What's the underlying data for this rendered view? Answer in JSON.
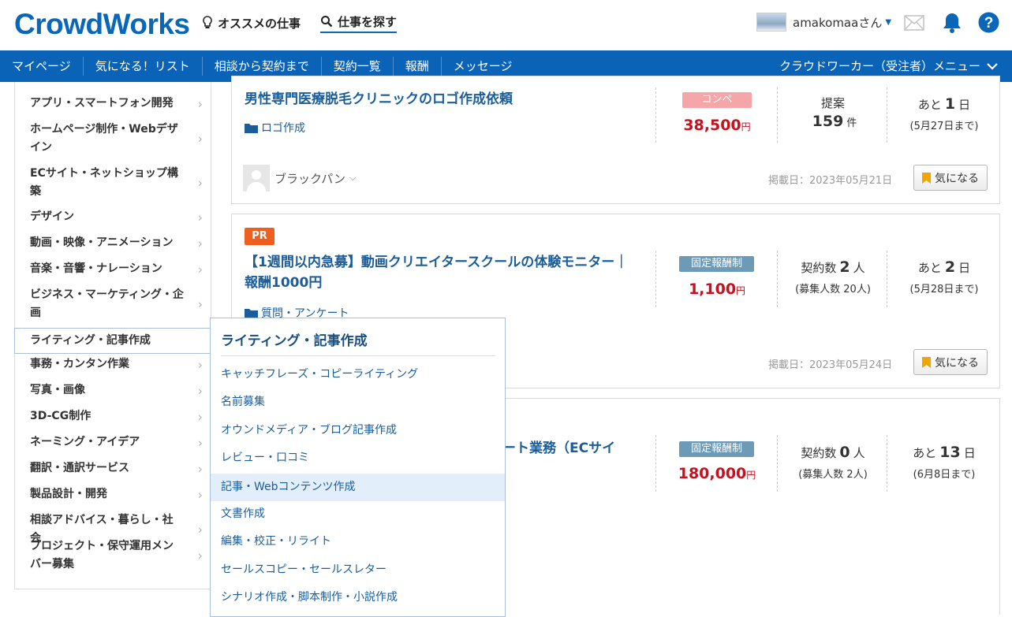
{
  "header": {
    "logo": "CrowdWorks",
    "recommend": "オススメの仕事",
    "search": "仕事を探す",
    "username": "amakomaaさん",
    "icons": [
      "mail-icon",
      "bell-icon",
      "help-icon"
    ]
  },
  "nav": {
    "items": [
      "マイページ",
      "気になる！リスト",
      "相談から契約まで",
      "契約一覧",
      "報酬",
      "メッセージ"
    ],
    "worker_menu": "クラウドワーカー（受注者）メニュー"
  },
  "sidebar": {
    "items": [
      "アプリ・スマートフォン開発",
      "ホームページ制作・Webデザイン",
      "ECサイト・ネットショップ構築",
      "デザイン",
      "動画・映像・アニメーション",
      "音楽・音響・ナレーション",
      "ビジネス・マーケティング・企画",
      "ライティング・記事作成",
      "事務・カンタン作業",
      "写真・画像",
      "3D-CG制作",
      "ネーミング・アイデア",
      "翻訳・通訳サービス",
      "製品設計・開発",
      "相談アドバイス・暮らし・社会",
      "プロジェクト・保守運用メンバー募集"
    ],
    "active": "ライティング・記事作成"
  },
  "dropdown": {
    "title": "ライティング・記事作成",
    "items": [
      "キャッチフレーズ・コピーライティング",
      "名前募集",
      "オウンドメディア・ブログ記事作成",
      "レビュー・口コミ",
      "記事・Webコンテンツ作成",
      "文書作成",
      "編集・校正・リライト",
      "セールスコピー・セールスレター",
      "シナリオ作成・脚本制作・小説作成"
    ],
    "highlighted": "記事・Webコンテンツ作成"
  },
  "jobs": [
    {
      "title": "男性専門医療脱毛クリニックのロゴ作成依頼",
      "category": "ロゴ作成",
      "badge": "コンペ",
      "price": "38,500",
      "price_unit": "円",
      "stat_label": "提案",
      "stat_value": "159",
      "stat_unit": "件",
      "deadline_prefix": "あと",
      "deadline_days": "1",
      "deadline_unit": "日",
      "deadline_date": "(5月27日まで)",
      "client": "ブラックパン",
      "posted": "掲載日：2023年05月21日",
      "fav": "気になる"
    },
    {
      "pr": "PR",
      "title_line1": "【1週間以内急募】動画クリエイタースクールの体験モニター｜",
      "title_line2": "報酬1000円",
      "category": "質問・アンケート",
      "badge": "固定報酬制",
      "price": "1,100",
      "price_unit": "円",
      "stat_label": "契約数",
      "stat_value": "2",
      "stat_unit": "人",
      "stat_sub": "(募集人数 20人)",
      "deadline_prefix": "あと",
      "deadline_days": "2",
      "deadline_unit": "日",
      "deadline_date": "(5月28日まで)",
      "posted": "掲載日：2023年05月24日",
      "fav": "気になる"
    },
    {
      "title_fragment": "ート業務（ECサイ",
      "badge": "固定報酬制",
      "price": "180,000",
      "price_unit": "円",
      "stat_label": "契約数",
      "stat_value": "0",
      "stat_unit": "人",
      "stat_sub": "(募集人数 2人)",
      "deadline_prefix": "あと",
      "deadline_days": "13",
      "deadline_unit": "日",
      "deadline_date": "(6月8日まで)"
    }
  ],
  "colors": {
    "brand": "#0a66b8",
    "nav_bg": "#0b63b8",
    "price": "#c8101e",
    "pr_badge": "#ee5f1f"
  }
}
